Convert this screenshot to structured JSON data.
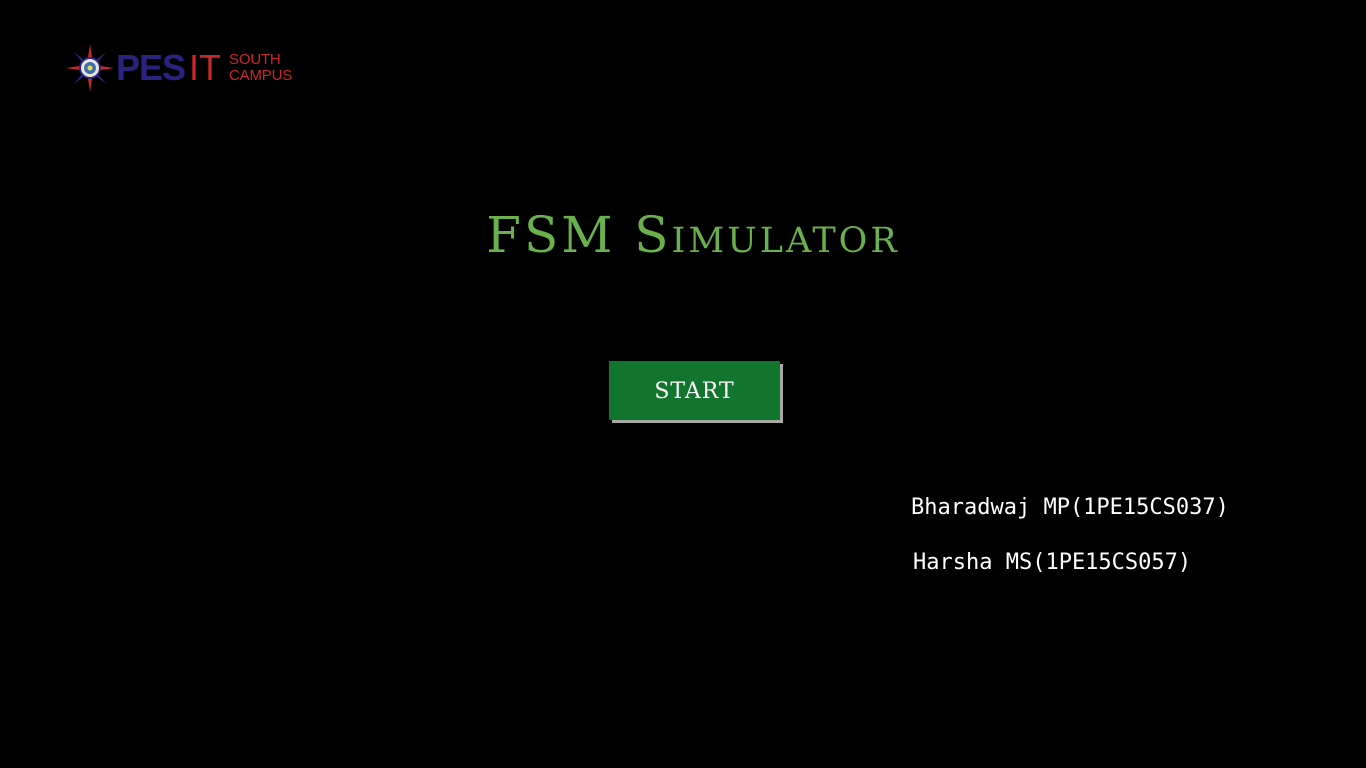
{
  "logo": {
    "brand_primary": "PES",
    "brand_secondary": "IT",
    "subtitle_line1": "SOUTH",
    "subtitle_line2": "CAMPUS",
    "emblem_icon": "compass-star-emblem-icon",
    "colors": {
      "blue": "#2b2380",
      "red": "#c8282a"
    }
  },
  "main": {
    "title": "FSM Simulator",
    "start_label": "START"
  },
  "authors": [
    {
      "text": "Bharadwaj MP(1PE15CS037)"
    },
    {
      "text": "Harsha MS(1PE15CS057)"
    }
  ],
  "colors": {
    "background": "#000000",
    "title": "#6ab04c",
    "button": "#12752e",
    "button_text": "#ffffff",
    "author_text": "#ffffff"
  }
}
